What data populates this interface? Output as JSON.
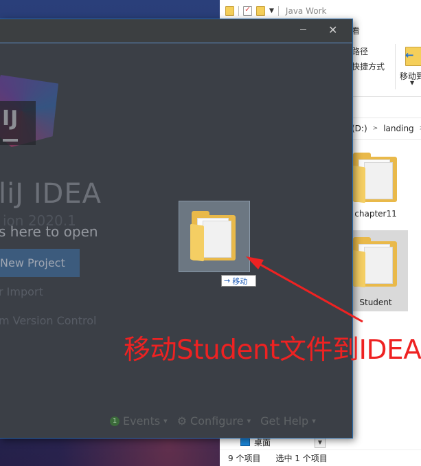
{
  "explorer": {
    "title": "Java Work",
    "ribbon_tab_partial": "看",
    "ribbon_copy_path": "路径",
    "ribbon_paste_shortcut": "快捷方式",
    "move_to_label": "移动到",
    "breadcrumb": [
      "(D:)",
      "landing"
    ],
    "items": [
      {
        "name": "chapter11",
        "selected": false
      },
      {
        "name": "Student",
        "selected": true
      }
    ],
    "nav_item": "桌面",
    "status_count": "9 个项目",
    "status_selected": "选中 1 个项目"
  },
  "intellij": {
    "app_name": "liJ IDEA",
    "version": "ion 2020.1",
    "drop_hint": "s here to open",
    "new_project": "New Project",
    "import_link": "r Import",
    "vcs_link": "m Version Control",
    "events_count": "1",
    "events_label": "Events",
    "configure_label": "Configure",
    "help_label": "Get Help"
  },
  "drag": {
    "tooltip": "移动"
  },
  "annotation": {
    "text": "移动Student文件到IDEA",
    "color": "#ee2222"
  }
}
